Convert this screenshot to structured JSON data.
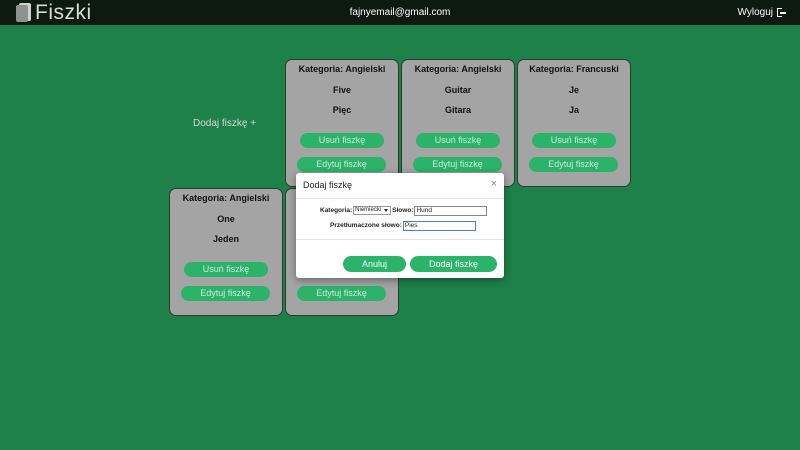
{
  "navbar": {
    "brand": "Fiszki",
    "user_email": "fajnyemail@gmail.com",
    "logout_label": "Wyloguj"
  },
  "add_flashcard_link": "Dodaj fiszkę +",
  "cards": [
    {
      "category": "Kategoria: Angielski",
      "word": "Five",
      "translation": "Pięc",
      "delete_label": "Usuń fiszkę",
      "edit_label": "Edytuj fiszkę"
    },
    {
      "category": "Kategoria: Angielski",
      "word": "Guitar",
      "translation": "Gitara",
      "delete_label": "Usuń fiszkę",
      "edit_label": "Edytuj fiszkę"
    },
    {
      "category": "Kategoria: Francuski",
      "word": "Je",
      "translation": "Ja",
      "delete_label": "Usuń fiszkę",
      "edit_label": "Edytuj fiszkę"
    },
    {
      "category": "Kategoria: Angielski",
      "word": "One",
      "translation": "Jeden",
      "delete_label": "Usuń fiszkę",
      "edit_label": "Edytuj fiszkę"
    },
    {
      "edit_label": "Edytuj fiszkę"
    }
  ],
  "modal": {
    "title": "Dodaj fiszkę",
    "close_symbol": "×",
    "category_label": "Kategoria:",
    "category_selected": "Niemiecki",
    "word_label": "Słowo:",
    "word_value": "Hund",
    "translation_label": "Przetłumaczone słowo:",
    "translation_value": "Pies",
    "cancel_label": "Anuluj",
    "submit_label": "Dodaj fiszkę"
  },
  "colors": {
    "background": "#1e8149",
    "navbar": "#0c1a10",
    "card": "#a4a4a4",
    "button": "#2bb36a"
  }
}
